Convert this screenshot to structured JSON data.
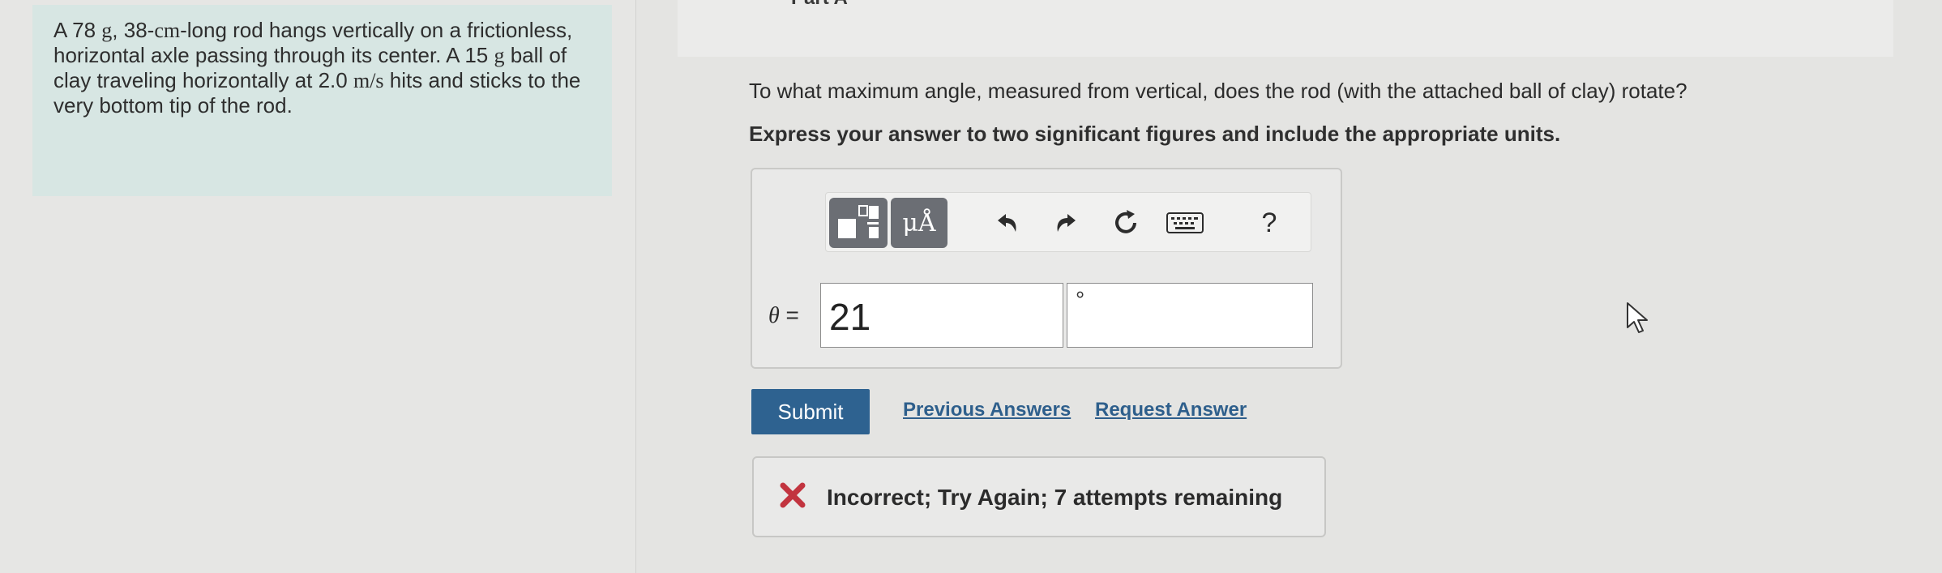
{
  "problem": {
    "p1": "A 78",
    "u1": "g",
    "p2": ", 38-",
    "u2": "cm",
    "p3": "-long rod hangs vertically on a frictionless, horizontal axle passing through its center. A 15",
    "u3": "g",
    "p4": "ball of clay traveling horizontally at 2.0",
    "u4": "m/s",
    "p5": "hits and sticks to the very bottom tip of the rod."
  },
  "part": {
    "title": "Part A"
  },
  "question": "To what maximum angle, measured from vertical, does the rod (with the attached ball of clay) rotate?",
  "instruction": "Express your answer to two significant figures and include the appropriate units.",
  "toolbar": {
    "units_label": "μÅ",
    "help_label": "?"
  },
  "answer": {
    "variable": "θ",
    "equals": "=",
    "value": "21",
    "unit": "°"
  },
  "actions": {
    "submit_label": "Submit",
    "previous_answers_label": "Previous Answers",
    "request_answer_label": "Request Answer"
  },
  "feedback": {
    "icon": "x-icon",
    "text": "Incorrect; Try Again; 7 attempts remaining",
    "color": "#c2343f"
  }
}
